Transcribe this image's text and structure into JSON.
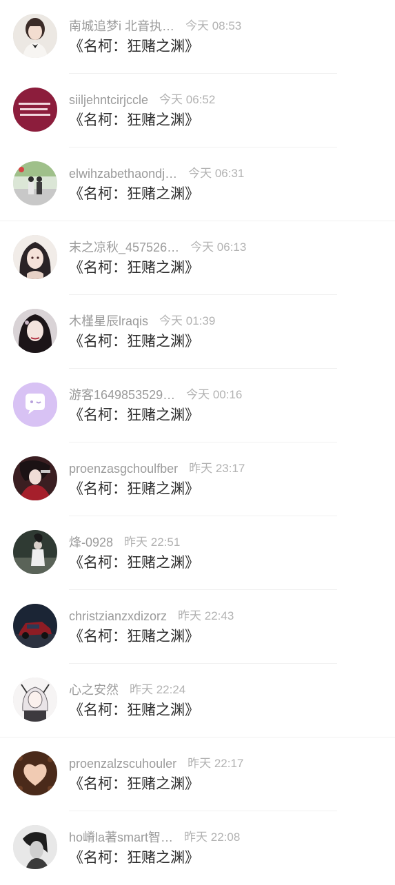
{
  "comments": [
    {
      "name": "南城追梦i 北音执…",
      "time": "今天 08:53",
      "text": "《名柯：狂赌之渊》",
      "avatar": "girl-portrait-avatar"
    },
    {
      "name": "siiljehntcirjccle",
      "time": "今天 06:52",
      "text": "《名柯：狂赌之渊》",
      "avatar": "text-card-avatar"
    },
    {
      "name": "elwihzabethaondj…",
      "time": "今天 06:31",
      "text": "《名柯：狂赌之渊》",
      "avatar": "street-couple-avatar"
    },
    {
      "name": "末之凉秋_457526…",
      "time": "今天 06:13",
      "text": "《名柯：狂赌之渊》",
      "avatar": "anime-girl-avatar"
    },
    {
      "name": "木槿星辰lraqis",
      "time": "今天 01:39",
      "text": "《名柯：狂赌之渊》",
      "avatar": "actress-avatar"
    },
    {
      "name": "游客1649853529…",
      "time": "今天 00:16",
      "text": "《名柯：狂赌之渊》",
      "avatar": "default-guest-avatar"
    },
    {
      "name": "proenzasgchoulfber",
      "time": "昨天 23:17",
      "text": "《名柯：狂赌之渊》",
      "avatar": "anime-red-avatar"
    },
    {
      "name": "烽-0928",
      "time": "昨天 22:51",
      "text": "《名柯：狂赌之渊》",
      "avatar": "dark-photo-avatar"
    },
    {
      "name": "christzianzxdizorz",
      "time": "昨天 22:43",
      "text": "《名柯：狂赌之渊》",
      "avatar": "car-avatar"
    },
    {
      "name": "心之安然",
      "time": "昨天 22:24",
      "text": "《名柯：狂赌之渊》",
      "avatar": "anime-sketch-avatar"
    },
    {
      "name": "proenzalzscuhouler",
      "time": "昨天 22:17",
      "text": "《名柯：狂赌之渊》",
      "avatar": "coffee-heart-avatar"
    },
    {
      "name": "ho嵴la著smart智…",
      "time": "昨天 22:08",
      "text": "《名柯：狂赌之渊》",
      "avatar": "bw-portrait-avatar"
    }
  ],
  "colors": {
    "name": "#9b9b9b",
    "time": "#b2b2b2",
    "comment": "#2b2b2b",
    "divider": "#f0f0f0"
  }
}
